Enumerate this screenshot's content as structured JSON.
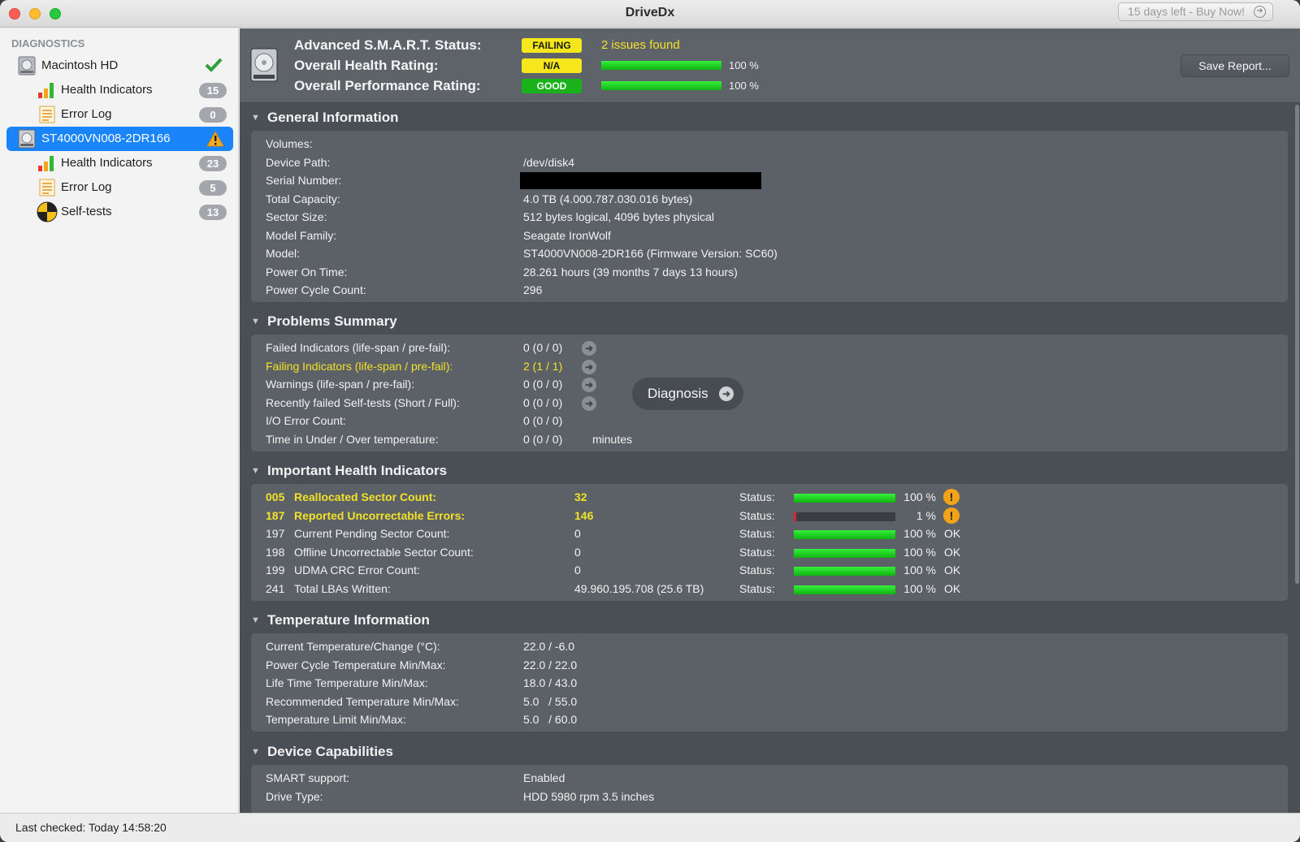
{
  "window": {
    "title": "DriveDx",
    "buy_label": "15 days left - Buy Now!",
    "buy_icon": "arrow-circle-icon"
  },
  "sidebar": {
    "header": "DIAGNOSTICS",
    "items": [
      {
        "label": "Macintosh HD",
        "icon": "disk-icon",
        "status_icon": "checkmark-icon"
      },
      {
        "label": "Health Indicators",
        "badge": "15",
        "icon": "bar-chart-icon"
      },
      {
        "label": "Error Log",
        "badge": "0",
        "icon": "log-icon"
      },
      {
        "label": "ST4000VN008-2DR166",
        "icon": "disk-icon",
        "status_icon": "warning-triangle-icon",
        "selected": true
      },
      {
        "label": "Health Indicators",
        "badge": "23",
        "icon": "bar-chart-icon"
      },
      {
        "label": "Error Log",
        "badge": "5",
        "icon": "log-icon"
      },
      {
        "label": "Self-tests",
        "badge": "13",
        "icon": "self-test-icon"
      }
    ]
  },
  "footer": {
    "last_checked": "Last checked: Today 14:58:20"
  },
  "header": {
    "smart_label": "Advanced S.M.A.R.T. Status:",
    "smart_status": "FAILING",
    "issues": "2 issues found",
    "health_label": "Overall Health Rating:",
    "health_status": "N/A",
    "health_pct": "100 %",
    "health_fraction": 1.0,
    "perf_label": "Overall Performance Rating:",
    "perf_status": "GOOD",
    "perf_pct": "100 %",
    "perf_fraction": 1.0,
    "save_button": "Save Report...",
    "colors": {
      "failing": "#f6e61c",
      "good": "#19b21a"
    }
  },
  "general": {
    "title": "General Information",
    "rows": [
      {
        "label": "Volumes:",
        "value": ""
      },
      {
        "label": "Device Path:",
        "value": "/dev/disk4"
      },
      {
        "label": "Serial Number:",
        "value": ""
      },
      {
        "label": "Total Capacity:",
        "value": "4.0 TB (4.000.787.030.016 bytes)"
      },
      {
        "label": "Sector Size:",
        "value": "512 bytes logical, 4096 bytes physical"
      },
      {
        "label": "Model Family:",
        "value": "Seagate IronWolf"
      },
      {
        "label": "Model:",
        "value": "ST4000VN008-2DR166  (Firmware Version: SC60)"
      },
      {
        "label": "Power On Time:",
        "value": "28.261 hours (39 months 7 days 13 hours)"
      },
      {
        "label": "Power Cycle Count:",
        "value": "296"
      }
    ]
  },
  "problems": {
    "title": "Problems Summary",
    "rows": [
      {
        "label": "Failed Indicators (life-span / pre-fail):",
        "value": "0 (0 / 0)"
      },
      {
        "label": "Failing Indicators (life-span / pre-fail):",
        "value": "2 (1 / 1)"
      },
      {
        "label": "Warnings (life-span / pre-fail):",
        "value": "0 (0 / 0)"
      },
      {
        "label": "Recently failed Self-tests (Short / Full):",
        "value": "0 (0 / 0)"
      },
      {
        "label": "I/O Error Count:",
        "value": "0 (0 / 0)"
      },
      {
        "label": "Time in Under / Over temperature:",
        "value": "0 (0 / 0)",
        "unit": "minutes"
      }
    ],
    "diagnosis_button": "Diagnosis"
  },
  "indicators": {
    "title": "Important Health Indicators",
    "status_label": "Status:",
    "rows": [
      {
        "id": "005",
        "name": "Reallocated Sector Count:",
        "value": "32",
        "pct": "100 %",
        "fraction": 1.0,
        "status": "!"
      },
      {
        "id": "187",
        "name": "Reported Uncorrectable Errors:",
        "value": "146",
        "pct": "1 %",
        "fraction": 0.01,
        "status": "!"
      },
      {
        "id": "197",
        "name": "Current Pending Sector Count:",
        "value": "0",
        "pct": "100 %",
        "fraction": 1.0,
        "status": "OK"
      },
      {
        "id": "198",
        "name": "Offline Uncorrectable Sector Count:",
        "value": "0",
        "pct": "100 %",
        "fraction": 1.0,
        "status": "OK"
      },
      {
        "id": "199",
        "name": "UDMA CRC Error Count:",
        "value": "0",
        "pct": "100 %",
        "fraction": 1.0,
        "status": "OK"
      },
      {
        "id": "241",
        "name": "Total LBAs Written:",
        "value": "49.960.195.708 (25.6 TB)",
        "pct": "100 %",
        "fraction": 1.0,
        "status": "OK"
      }
    ]
  },
  "temperature": {
    "title": "Temperature Information",
    "rows": [
      {
        "label": "Current Temperature/Change (°C):",
        "value": "22.0 / -6.0"
      },
      {
        "label": "Power Cycle Temperature Min/Max:",
        "value": "22.0 / 22.0"
      },
      {
        "label": "Life Time Temperature Min/Max:",
        "value": "18.0 / 43.0"
      },
      {
        "label": "Recommended Temperature Min/Max:",
        "value": "5.0   / 55.0"
      },
      {
        "label": "Temperature Limit Min/Max:",
        "value": "5.0   / 60.0"
      }
    ]
  },
  "capabilities": {
    "title": "Device Capabilities",
    "rows": [
      {
        "label": "SMART support:",
        "value": "Enabled"
      },
      {
        "label": "Drive Type:",
        "value": "HDD 5980 rpm 3.5 inches"
      }
    ]
  }
}
